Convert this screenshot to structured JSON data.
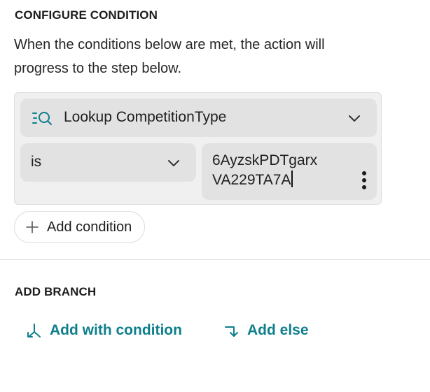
{
  "configure": {
    "title": "CONFIGURE CONDITION",
    "description_line1": "When the conditions below are met, the action will",
    "description_line2": "progress to the step below."
  },
  "condition": {
    "lookup_label": "Lookup CompetitionType",
    "lookup_icon": "lookup-search-icon",
    "operator_value": "is",
    "value_line1": "6AyzskPDTgarx",
    "value_line2": "VA229TA7A"
  },
  "add_condition": {
    "label": "Add condition",
    "icon": "plus-icon"
  },
  "branch": {
    "title": "ADD BRANCH",
    "add_with_condition_label": "Add with condition",
    "add_else_label": "Add else"
  },
  "colors": {
    "accent": "#0e7f8c",
    "field_bg": "#e2e2e2",
    "box_bg": "#f0f0f0"
  }
}
